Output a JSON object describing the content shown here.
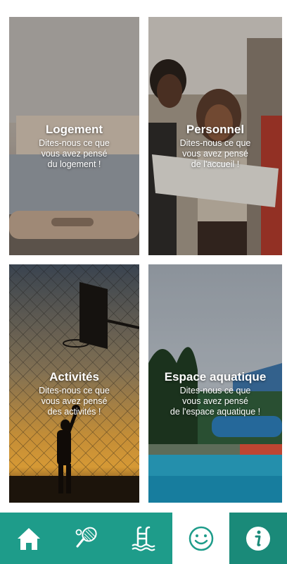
{
  "cards": {
    "logement": {
      "title": "Logement",
      "desc_lines": [
        "Dites-nous ce que",
        "vous avez pensé",
        "du logement !"
      ]
    },
    "personnel": {
      "title": "Personnel",
      "desc_lines": [
        "Dites-nous ce que",
        "vous avez pensé",
        "de l'accueil !"
      ]
    },
    "activites": {
      "title": "Activités",
      "desc_lines": [
        "Dites-nous ce que",
        "vous avez pensé",
        "des activités !"
      ]
    },
    "aquatique": {
      "title": "Espace aquatique",
      "desc_lines": [
        "Dites-nous ce que",
        "vous avez pensé",
        "de l'espace aquatique !"
      ]
    }
  },
  "nav": {
    "items": [
      {
        "icon": "home-icon"
      },
      {
        "icon": "tennis-racket-icon"
      },
      {
        "icon": "pool-ladder-icon"
      },
      {
        "icon": "smiley-icon",
        "active": true
      },
      {
        "icon": "info-icon"
      }
    ]
  },
  "colors": {
    "nav_bg": "#1e9c8a",
    "nav_active_bg": "#ffffff",
    "icon_active": "#1e9c8a"
  }
}
